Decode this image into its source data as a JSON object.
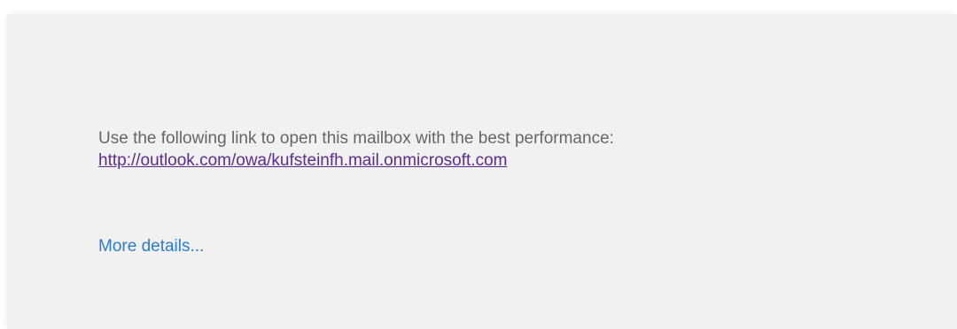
{
  "message": {
    "intro_text": "Use the following link to open this mailbox with the best performance:",
    "link_text": "http://outlook.com/owa/kufsteinfh.mail.onmicrosoft.com"
  },
  "footer": {
    "more_details_label": "More details..."
  },
  "colors": {
    "panel_background": "#f1f1f1",
    "body_text": "#666666",
    "visited_link": "#5c2d91",
    "action_link": "#2b7cd3"
  }
}
